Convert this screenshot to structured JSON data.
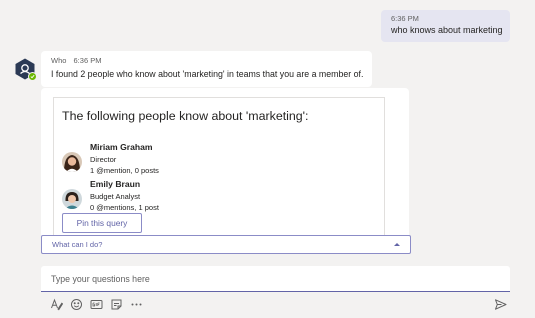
{
  "user_message": {
    "time": "6:36 PM",
    "text": "who knows about marketing"
  },
  "bot_message": {
    "sender": "Who",
    "time": "6:36 PM",
    "text": "I found 2 people who know about 'marketing' in teams that you are a member of."
  },
  "card": {
    "title": "The following people know about 'marketing':",
    "people": [
      {
        "name": "Miriam Graham",
        "role": "Director",
        "stats": "1 @mention, 0 posts"
      },
      {
        "name": "Emily Braun",
        "role": "Budget Analyst",
        "stats": "0 @mentions, 1 post"
      }
    ],
    "pin_button": "Pin this query"
  },
  "suggestion": {
    "label": "What can I do?"
  },
  "compose": {
    "placeholder": "Type your questions here"
  },
  "toolbar": {
    "icons": [
      "format-icon",
      "emoji-icon",
      "gif-icon",
      "sticker-icon",
      "more-options-icon"
    ],
    "send_icon": "send-icon"
  },
  "colors": {
    "accent": "#6264a7",
    "user_bubble": "#e5e5f1",
    "background": "#f3f2f1",
    "presence": "#6bb700"
  }
}
